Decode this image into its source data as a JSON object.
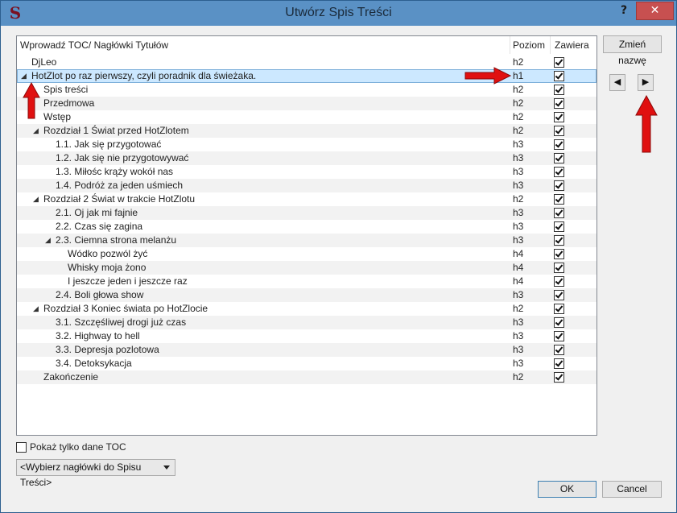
{
  "window": {
    "title": "Utwórz Spis Treści",
    "app_icon": "S",
    "help_label": "?",
    "close_label": "✕"
  },
  "columns": {
    "name": "Wprowadź TOC/ Nagłówki Tytułów",
    "level": "Poziom",
    "include": "Zawiera"
  },
  "rows": [
    {
      "label": "DjLeo",
      "level": "h2",
      "checked": true
    },
    {
      "label": "HotZlot po raz pierwszy, czyli poradnik dla świeżaka.",
      "level": "h1",
      "checked": true,
      "expander": "◢",
      "selected": true
    },
    {
      "label": "Spis treści",
      "level": "h2",
      "checked": true
    },
    {
      "label": "Przedmowa",
      "level": "h2",
      "checked": true
    },
    {
      "label": "Wstęp",
      "level": "h2",
      "checked": true
    },
    {
      "label": "Rozdział 1 Świat przed HotZlotem",
      "level": "h2",
      "checked": true,
      "expander": "◢"
    },
    {
      "label": "1.1. Jak się przygotować",
      "level": "h3",
      "checked": true
    },
    {
      "label": "1.2. Jak się nie przygotowywać",
      "level": "h3",
      "checked": true
    },
    {
      "label": "1.3. Miłośc krąży wokół nas",
      "level": "h3",
      "checked": true
    },
    {
      "label": "1.4. Podróż za jeden uśmiech",
      "level": "h3",
      "checked": true
    },
    {
      "label": "Rozdział 2 Świat w trakcie HotZlotu",
      "level": "h2",
      "checked": true,
      "expander": "◢"
    },
    {
      "label": "2.1. Oj jak mi fajnie",
      "level": "h3",
      "checked": true
    },
    {
      "label": "2.2. Czas się zagina",
      "level": "h3",
      "checked": true
    },
    {
      "label": "2.3. Ciemna strona melanżu",
      "level": "h3",
      "checked": true,
      "expander": "◢"
    },
    {
      "label": "Wódko pozwól żyć",
      "level": "h4",
      "checked": true
    },
    {
      "label": "Whisky moja żono",
      "level": "h4",
      "checked": true
    },
    {
      "label": "I jeszcze jeden i jeszcze raz",
      "level": "h4",
      "checked": true
    },
    {
      "label": "2.4. Boli głowa show",
      "level": "h3",
      "checked": true
    },
    {
      "label": "Rozdział 3 Koniec świata po HotZlocie",
      "level": "h2",
      "checked": true,
      "expander": "◢"
    },
    {
      "label": "3.1. Szczęśliwej drogi już czas",
      "level": "h3",
      "checked": true
    },
    {
      "label": "3.2. Highway to hell",
      "level": "h3",
      "checked": true
    },
    {
      "label": "3.3. Depresja pozlotowa",
      "level": "h3",
      "checked": true
    },
    {
      "label": "3.4. Detoksykacja",
      "level": "h3",
      "checked": true
    },
    {
      "label": "Zakończenie",
      "level": "h2",
      "checked": true
    }
  ],
  "buttons": {
    "rename": "Zmień nazwę",
    "prev_icon": "◀",
    "next_icon": "▶",
    "ok": "OK",
    "cancel": "Cancel"
  },
  "options": {
    "toc_only_label": "Pokaż tylko dane TOC",
    "toc_only_checked": false,
    "select_headings": "<Wybierz nagłówki do Spisu Treści>"
  },
  "icons": {
    "expander": "collapse-triangle-icon",
    "prev": "triangle-left-icon",
    "next": "triangle-right-icon",
    "annotation_arrows": "red-arrow-icon"
  },
  "colors": {
    "titlebar": "#5a91c5",
    "selection": "#cce8ff",
    "annotation": "#e01010",
    "close_button": "#c75050"
  }
}
